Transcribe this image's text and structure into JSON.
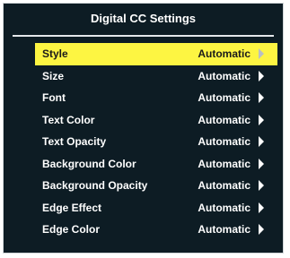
{
  "window": {
    "title": "Digital CC Settings"
  },
  "colors": {
    "panel_bg": "#0d1c24",
    "highlight": "#fdf542",
    "text": "#ffffff",
    "arrow_selected": "#b9bfc4"
  },
  "menu": {
    "items": [
      {
        "label": "Style",
        "value": "Automatic",
        "icon": "chevron-right-icon",
        "selected": true
      },
      {
        "label": "Size",
        "value": "Automatic",
        "icon": "chevron-right-icon",
        "selected": false
      },
      {
        "label": "Font",
        "value": "Automatic",
        "icon": "chevron-right-icon",
        "selected": false
      },
      {
        "label": "Text Color",
        "value": "Automatic",
        "icon": "chevron-right-icon",
        "selected": false
      },
      {
        "label": "Text Opacity",
        "value": "Automatic",
        "icon": "chevron-right-icon",
        "selected": false
      },
      {
        "label": "Background Color",
        "value": "Automatic",
        "icon": "chevron-right-icon",
        "selected": false
      },
      {
        "label": "Background Opacity",
        "value": "Automatic",
        "icon": "chevron-right-icon",
        "selected": false
      },
      {
        "label": "Edge Effect",
        "value": "Automatic",
        "icon": "chevron-right-icon",
        "selected": false
      },
      {
        "label": "Edge Color",
        "value": "Automatic",
        "icon": "chevron-right-icon",
        "selected": false
      }
    ]
  }
}
